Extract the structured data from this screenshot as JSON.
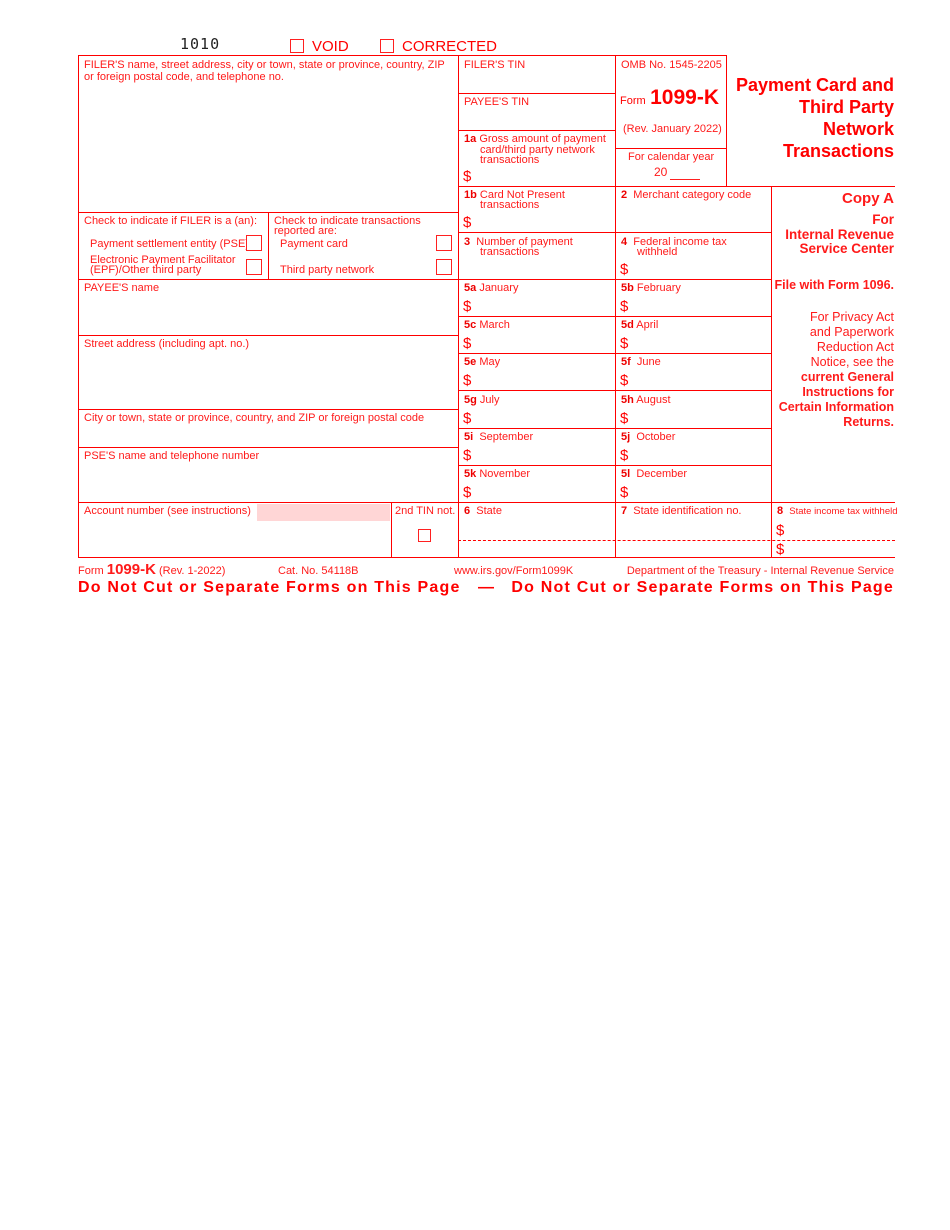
{
  "header": {
    "form_code": "1010",
    "void_label": "VOID",
    "corrected_label": "CORRECTED"
  },
  "filer": {
    "name_label_line1": "FILER'S name, street address, city or town, state or province, country, ZIP",
    "name_label_line2": "or foreign postal code, and telephone no.",
    "tin_label": "FILER'S TIN",
    "payee_tin_label": "PAYEE'S TIN",
    "check_filer_label": "Check to indicate if FILER is a (an):",
    "pse_label": "Payment settlement entity (PSE)",
    "epf_label_line1": "Electronic Payment Facilitator",
    "epf_label_line2": "(EPF)/Other third party",
    "check_trans_label_line1": "Check to indicate transactions",
    "check_trans_label_line2": "reported are:",
    "payment_card_label": "Payment card",
    "third_party_label": "Third party network"
  },
  "form_id": {
    "omb": "OMB No. 1545-2205",
    "form_word": "Form",
    "form_number": "1099-K",
    "revision": "(Rev. January 2022)",
    "cal_year_label": "For calendar year",
    "cal_year_prefix": "20",
    "title_lines": [
      "Payment Card and",
      "Third Party",
      "Network",
      "Transactions"
    ]
  },
  "boxes": {
    "b1a_num": "1a",
    "b1a_text1": "Gross amount of payment",
    "b1a_text2": "card/third party network",
    "b1a_text3": "transactions",
    "b1b_num": "1b",
    "b1b_text1": "Card Not Present",
    "b1b_text2": "transactions",
    "b2_num": "2",
    "b2_text": "Merchant category code",
    "b3_num": "3",
    "b3_text1": "Number of payment",
    "b3_text2": "transactions",
    "b4_num": "4",
    "b4_text1": "Federal income tax",
    "b4_text2": "withheld",
    "dollar": "$",
    "months": [
      {
        "num": "5a",
        "label": "January"
      },
      {
        "num": "5b",
        "label": "February"
      },
      {
        "num": "5c",
        "label": "March"
      },
      {
        "num": "5d",
        "label": "April"
      },
      {
        "num": "5e",
        "label": "May"
      },
      {
        "num": "5f",
        "label": "June"
      },
      {
        "num": "5g",
        "label": "July"
      },
      {
        "num": "5h",
        "label": "August"
      },
      {
        "num": "5i",
        "label": "September"
      },
      {
        "num": "5j",
        "label": "October"
      },
      {
        "num": "5k",
        "label": "November"
      },
      {
        "num": "5l",
        "label": "December"
      }
    ],
    "b6_num": "6",
    "b6_text": "State",
    "b7_num": "7",
    "b7_text": "State identification no.",
    "b8_num": "8",
    "b8_text": "State income tax withheld"
  },
  "payee": {
    "name_label": "PAYEE'S name",
    "street_label": "Street address (including apt. no.)",
    "city_label": "City or town, state or province, country, and ZIP or foreign postal code",
    "pse_name_label": "PSE'S name and telephone number",
    "account_label": "Account number (see instructions)",
    "second_tin_label": "2nd TIN not."
  },
  "side": {
    "copy": "Copy A",
    "for": "For",
    "irs_line1": "Internal Revenue",
    "irs_line2": "Service Center",
    "file_with": "File with Form 1096.",
    "privacy_lines": [
      "For Privacy Act",
      "and Paperwork",
      "Reduction Act",
      "Notice, see the"
    ],
    "instr_lines": [
      "current General",
      "Instructions for",
      "Certain Information",
      "Returns."
    ]
  },
  "footer": {
    "form_word": "Form",
    "form_number": "1099-K",
    "rev": "(Rev. 1-2022)",
    "cat": "Cat. No. 54118B",
    "url": "www.irs.gov/Form1099K",
    "dept": "Department of the Treasury - Internal Revenue Service",
    "warning": "Do Not Cut or Separate Forms on This Page",
    "dash": "—"
  }
}
